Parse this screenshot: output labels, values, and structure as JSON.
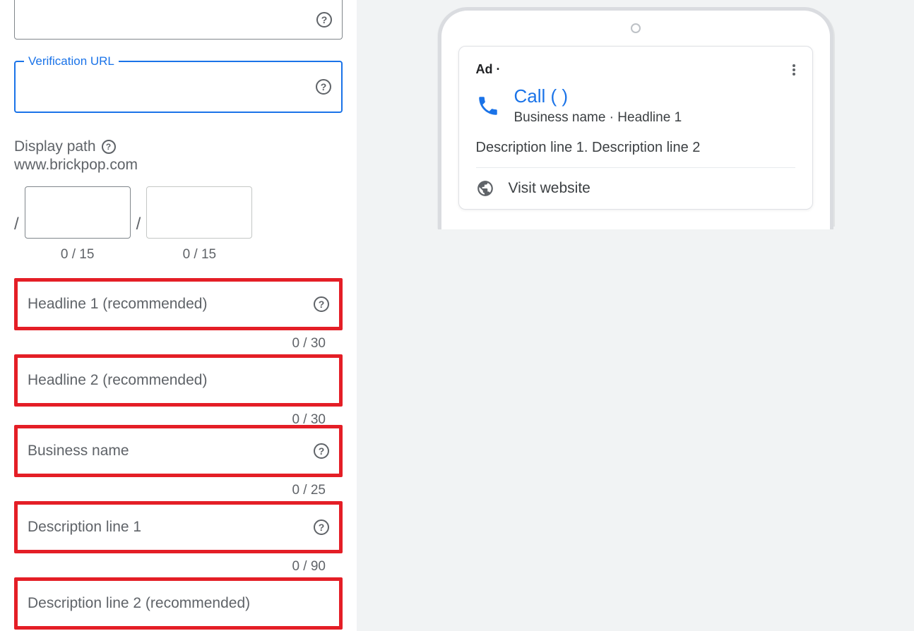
{
  "form": {
    "top_field": {
      "value": ""
    },
    "verification_url": {
      "label": "Verification URL",
      "value": ""
    },
    "display_path": {
      "label": "Display path",
      "base_url": "www.brickpop.com",
      "path1": {
        "value": "",
        "counter": "0 / 15"
      },
      "path2": {
        "value": "",
        "counter": "0 / 15"
      }
    },
    "headline1": {
      "placeholder": "Headline 1 (recommended)",
      "value": "",
      "counter": "0 / 30"
    },
    "headline2": {
      "placeholder": "Headline 2 (recommended)",
      "value": "",
      "counter": "0 / 30"
    },
    "business_name": {
      "placeholder": "Business name",
      "value": "",
      "counter": "0 / 25"
    },
    "description1": {
      "placeholder": "Description line 1",
      "value": "",
      "counter": "0 / 90"
    },
    "description2": {
      "placeholder": "Description line 2 (recommended)",
      "value": ""
    }
  },
  "preview": {
    "ad_badge": "Ad   ·",
    "call_title": "Call (        )",
    "subline": "Business name · Headline 1",
    "description": "Description line 1. Description line 2",
    "visit": "Visit website"
  }
}
